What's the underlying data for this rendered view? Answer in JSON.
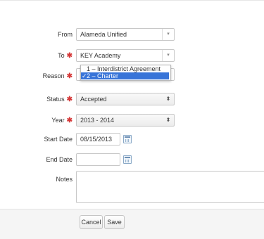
{
  "form": {
    "from": {
      "label": "From",
      "value": "Alameda Unified"
    },
    "to": {
      "label": "To",
      "value": "KEY Academy",
      "required": "✱"
    },
    "reason": {
      "label": "Reason",
      "required": "✱",
      "options": [
        "1 – Interdistrict Agreement",
        "2 – Charter"
      ],
      "selected_check": "✓"
    },
    "status": {
      "label": "Status",
      "value": "Accepted",
      "required": "✱"
    },
    "year": {
      "label": "Year",
      "value": "2013 - 2014",
      "required": "✱"
    },
    "start_date": {
      "label": "Start Date",
      "value": "08/15/2013"
    },
    "end_date": {
      "label": "End Date",
      "value": ""
    },
    "notes": {
      "label": "Notes",
      "value": ""
    }
  },
  "buttons": {
    "cancel": "Cancel",
    "save": "Save"
  },
  "icons": {
    "dropdown_arrow": "▾",
    "stepper_arrows": "⬍",
    "calendar": "calendar-icon"
  },
  "colors": {
    "required": "#d63a3a",
    "selected_option": "#3874d8"
  }
}
